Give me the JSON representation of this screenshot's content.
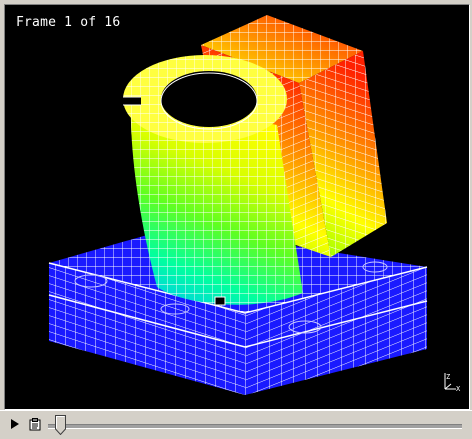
{
  "viewer": {
    "frame_label": "Frame 1 of 16",
    "background_color": "#000000",
    "mesh_color": "#ffffff",
    "base_color": "#1a1aff",
    "contour_colors": [
      "#ff2000",
      "#ff8000",
      "#ffff00",
      "#80ff00",
      "#00ff80",
      "#00c0ff"
    ]
  },
  "axis_indicator": {
    "labels": [
      "Z",
      "X"
    ]
  },
  "playback": {
    "play_icon": "play-icon",
    "record_icon": "clipboard-icon",
    "frame_current": 1,
    "frame_total": 16
  }
}
